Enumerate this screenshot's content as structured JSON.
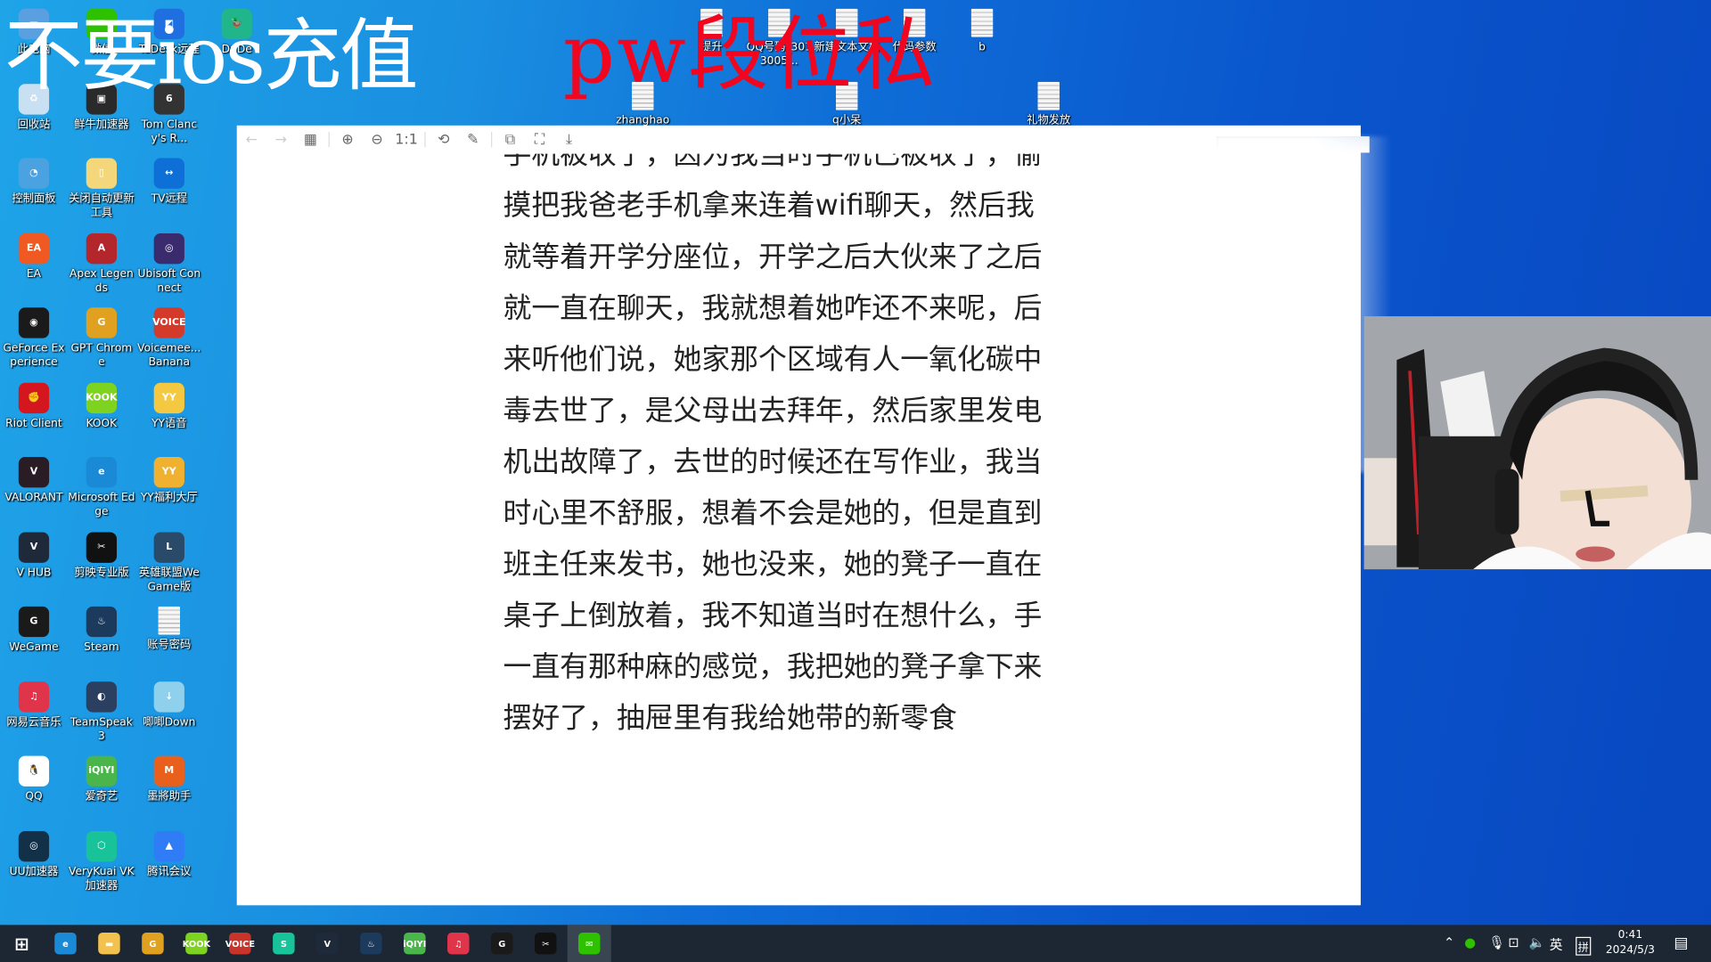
{
  "overlay": {
    "white_text": "不要ios充值",
    "red_text": "pw段位私",
    "red_color": "#f0061e"
  },
  "desktop_icons": [
    {
      "label": "此电脑",
      "color": "#5aa0e0",
      "glyph": "▭"
    },
    {
      "label": "微信",
      "color": "#2dc100",
      "glyph": "✉"
    },
    {
      "label": "ToDesk远程",
      "color": "#1f6fe0",
      "glyph": "◩"
    },
    {
      "label": "DuDe",
      "color": "#20b58a",
      "glyph": "🦆"
    },
    {
      "label": "回收站",
      "color": "#c9dff2",
      "glyph": "♻"
    },
    {
      "label": "鲜牛加速器",
      "color": "#2a2a2a",
      "glyph": "▣"
    },
    {
      "label": "Tom Clancy's R...",
      "color": "#333333",
      "glyph": "6"
    },
    {
      "label": "控制面板",
      "color": "#4aa3e0",
      "glyph": "◔"
    },
    {
      "label": "关闭自动更新工具",
      "color": "#f3d77a",
      "glyph": "▯"
    },
    {
      "label": "TV远程",
      "color": "#0e6fd6",
      "glyph": "↔"
    },
    {
      "label": "EA",
      "color": "#f05a22",
      "glyph": "EA"
    },
    {
      "label": "Apex Legends",
      "color": "#b3262b",
      "glyph": "A"
    },
    {
      "label": "Ubisoft Connect",
      "color": "#3a2b6e",
      "glyph": "◎"
    },
    {
      "label": "GeForce Experience",
      "color": "#1a1a1a",
      "glyph": "◉"
    },
    {
      "label": "GPT Chrome",
      "color": "#e0a020",
      "glyph": "G"
    },
    {
      "label": "Voicemee... Banana",
      "color": "#d43a2a",
      "glyph": "VOICE"
    },
    {
      "label": "Riot Client",
      "color": "#d4161e",
      "glyph": "✊"
    },
    {
      "label": "KOOK",
      "color": "#7ed321",
      "glyph": "KOOK"
    },
    {
      "label": "YY语音",
      "color": "#f5c842",
      "glyph": "YY"
    },
    {
      "label": "VALORANT",
      "color": "#2a1c24",
      "glyph": "V"
    },
    {
      "label": "Microsoft Edge",
      "color": "#1b8ad6",
      "glyph": "e"
    },
    {
      "label": "YY福利大厅",
      "color": "#f0b030",
      "glyph": "YY"
    },
    {
      "label": "V HUB",
      "color": "#1e2a3a",
      "glyph": "V"
    },
    {
      "label": "剪映专业版",
      "color": "#111111",
      "glyph": "✂"
    },
    {
      "label": "英雄联盟WeGame版",
      "color": "#2a4a6a",
      "glyph": "L"
    },
    {
      "label": "WeGame",
      "color": "#1a1a1a",
      "glyph": "G"
    },
    {
      "label": "Steam",
      "color": "#1b3a5c",
      "glyph": "♨"
    },
    {
      "label": "账号密码",
      "color": "file",
      "glyph": ""
    },
    {
      "label": "网易云音乐",
      "color": "#e0344a",
      "glyph": "♫"
    },
    {
      "label": "TeamSpeak 3",
      "color": "#2b3f60",
      "glyph": "◐"
    },
    {
      "label": "唧唧Down",
      "color": "#8fd0ec",
      "glyph": "↓"
    },
    {
      "label": "QQ",
      "color": "#ffffff",
      "glyph": "🐧"
    },
    {
      "label": "爱奇艺",
      "color": "#4ab54a",
      "glyph": "iQIYI"
    },
    {
      "label": "墨將助手",
      "color": "#e8601c",
      "glyph": "M"
    },
    {
      "label": "UU加速器",
      "color": "#123048",
      "glyph": "◎"
    },
    {
      "label": "VeryKuai VK加速器",
      "color": "#19c39a",
      "glyph": "⬡"
    },
    {
      "label": "腾讯会议",
      "color": "#2f7cf6",
      "glyph": "▲"
    }
  ],
  "top_files": [
    {
      "label": "提升"
    },
    {
      "label": "QQ号码_3013005..."
    },
    {
      "label": "新建文本文档"
    },
    {
      "label": "代码参数"
    },
    {
      "label": "b"
    },
    {
      "label": "zhanghao"
    },
    {
      "label": "q小呆"
    },
    {
      "label": "礼物发放"
    }
  ],
  "viewer": {
    "toolbar": [
      {
        "name": "back",
        "glyph": "←",
        "disabled": true
      },
      {
        "name": "forward",
        "glyph": "→",
        "disabled": true
      },
      {
        "name": "grid",
        "glyph": "▦"
      },
      {
        "name": "zoom-in",
        "glyph": "⊕"
      },
      {
        "name": "zoom-out",
        "glyph": "⊖"
      },
      {
        "name": "actual-size",
        "glyph": "1:1"
      },
      {
        "name": "rotate",
        "glyph": "⟲"
      },
      {
        "name": "edit",
        "glyph": "✎"
      },
      {
        "name": "translate",
        "glyph": "⧉"
      },
      {
        "name": "ocr",
        "glyph": "⛶"
      },
      {
        "name": "download",
        "glyph": "⤓"
      }
    ],
    "lines": [
      "手机被收了，因为我当时手机已被收了，偷",
      "摸把我爸老手机拿来连着wifi聊天，然后我",
      "就等着开学分座位，开学之后大伙来了之后",
      "就一直在聊天，我就想着她咋还不来呢，后",
      "来听他们说，她家那个区域有人一氧化碳中",
      "毒去世了，是父母出去拜年，然后家里发电",
      "机出故障了，去世的时候还在写作业，我当",
      "时心里不舒服，想着不会是她的，但是直到",
      "班主任来发书，她也没来，她的凳子一直在",
      "桌子上倒放着，我不知道当时在想什么，手",
      "一直有那种麻的感觉，我把她的凳子拿下来",
      "摆好了，抽屉里有我给她带的新零食"
    ]
  },
  "taskbar": {
    "apps": [
      {
        "name": "start",
        "glyph": "⊞",
        "color": "transparent"
      },
      {
        "name": "edge",
        "glyph": "e",
        "color": "#1b8ad6"
      },
      {
        "name": "file-explorer",
        "glyph": "▬",
        "color": "#f2c14e"
      },
      {
        "name": "chrome",
        "glyph": "G",
        "color": "#e0a020"
      },
      {
        "name": "kook",
        "glyph": "KOOK",
        "color": "#7ed321"
      },
      {
        "name": "voicemeeter",
        "glyph": "VOICE",
        "color": "#c9342a"
      },
      {
        "name": "verykuai",
        "glyph": "S",
        "color": "#19c39a"
      },
      {
        "name": "vhub",
        "glyph": "V",
        "color": "#1e2a3a"
      },
      {
        "name": "steam",
        "glyph": "♨",
        "color": "#1b3a5c"
      },
      {
        "name": "iqiyi",
        "glyph": "iQIYI",
        "color": "#4ab54a"
      },
      {
        "name": "netease-music",
        "glyph": "♫",
        "color": "#e0344a"
      },
      {
        "name": "wegame",
        "glyph": "G",
        "color": "#1a1a1a"
      },
      {
        "name": "capcut",
        "glyph": "✂",
        "color": "#111111"
      },
      {
        "name": "wechat",
        "glyph": "✉",
        "color": "#2dc100",
        "active": true
      }
    ],
    "tray": {
      "ime_lang": "英",
      "ime_mode": "拼",
      "time": "0:41",
      "date": "2024/5/3"
    }
  }
}
